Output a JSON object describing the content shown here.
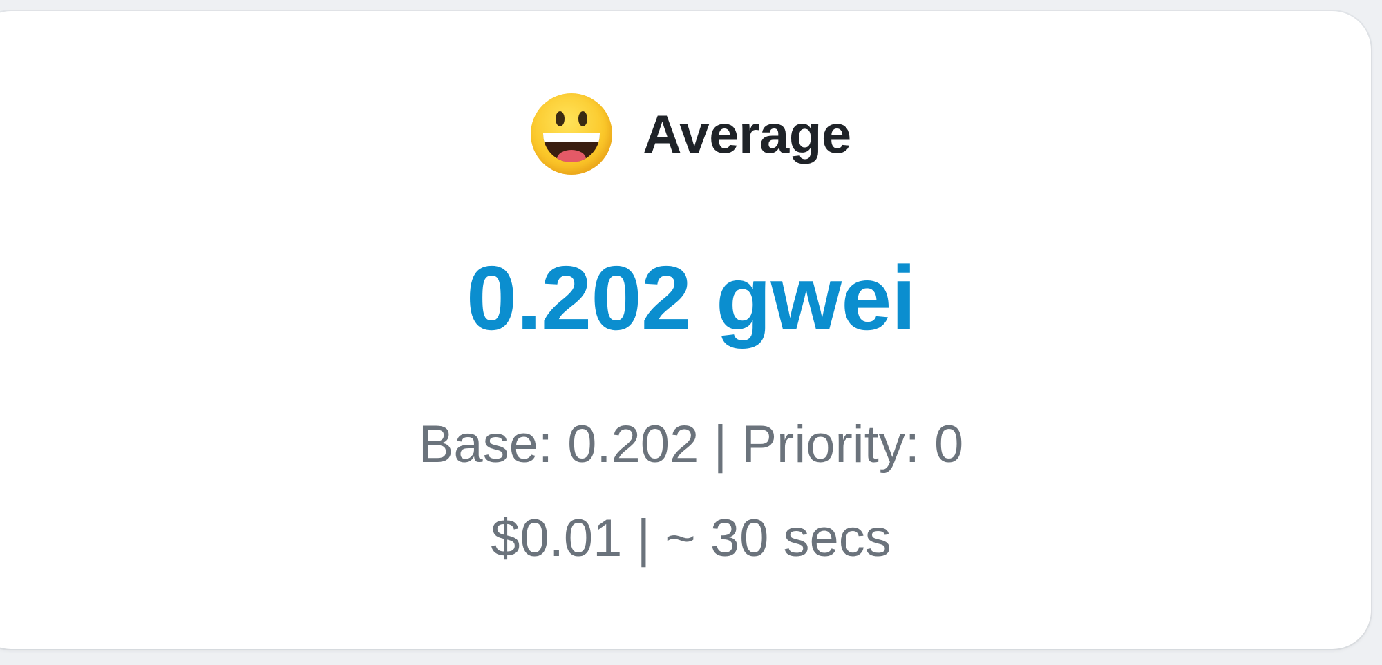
{
  "card": {
    "emoji_icon": "grinning-face-icon",
    "title": "Average",
    "gas_price": "0.202 gwei",
    "breakdown": "Base: 0.202 | Priority: 0",
    "cost_time": "$0.01 | ~ 30 secs"
  },
  "colors": {
    "accent": "#0b8ecf",
    "muted_text": "#6b737c",
    "title_text": "#1f2328",
    "card_bg": "#ffffff",
    "page_bg": "#eef0f3"
  }
}
